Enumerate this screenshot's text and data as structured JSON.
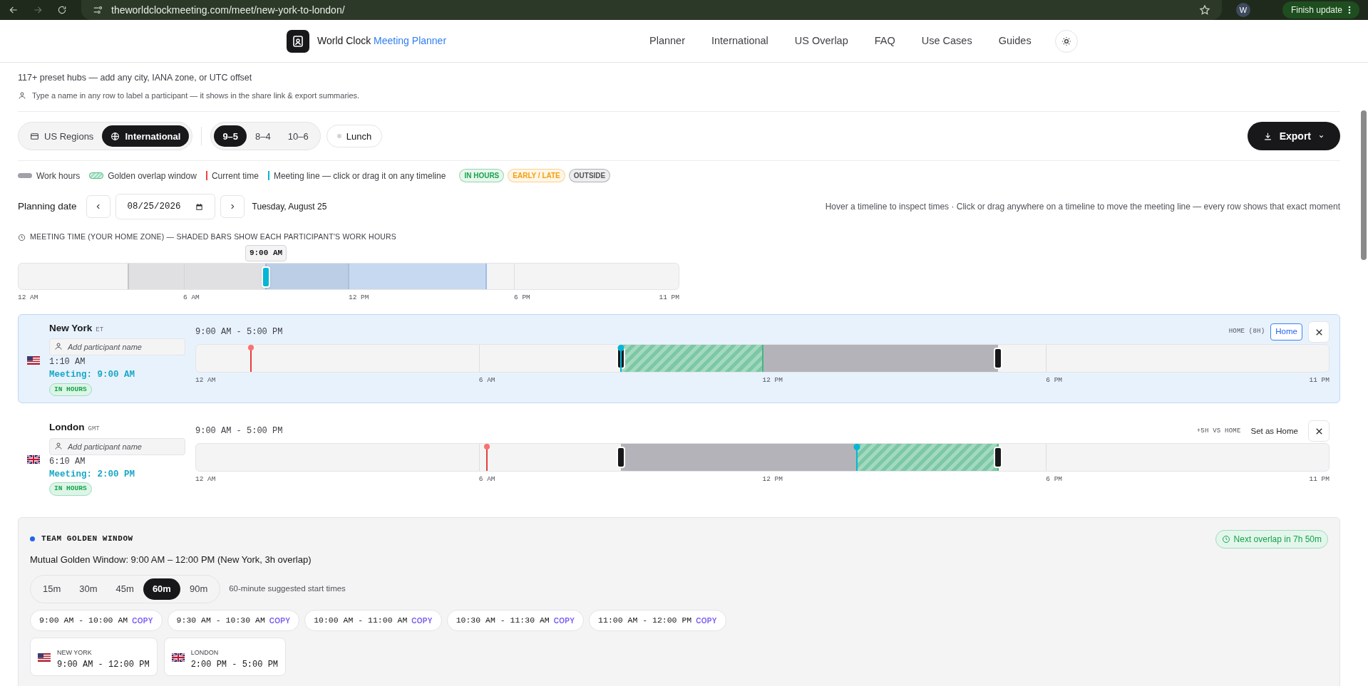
{
  "browser": {
    "url": "theworldclockmeeting.com/meet/new-york-to-london/",
    "avatar": "W",
    "update_button": "Finish update"
  },
  "header": {
    "logo_text": "World Clock",
    "logo_accent": "Meeting Planner",
    "nav": [
      "Planner",
      "International",
      "US Overlap",
      "FAQ",
      "Use Cases",
      "Guides"
    ]
  },
  "intro": {
    "subtitle": "117+ preset hubs — add any city, IANA zone, or UTC offset",
    "hint": "Type a name in any row to label a participant — it shows in the share link & export summaries."
  },
  "region_tabs": [
    {
      "label": "US Regions",
      "kind": "card",
      "selected": false
    },
    {
      "label": "International",
      "kind": "globe",
      "selected": true
    }
  ],
  "hour_presets": [
    {
      "label": "9–5",
      "selected": true
    },
    {
      "label": "8–4",
      "selected": false
    },
    {
      "label": "10–6",
      "selected": false
    }
  ],
  "lunch": {
    "label": "Lunch",
    "on": false
  },
  "export_button": "Export",
  "legend": [
    {
      "label": "Work hours",
      "kind": "work"
    },
    {
      "label": "Golden overlap window",
      "kind": "golden"
    },
    {
      "label": "Current time",
      "kind": "current"
    },
    {
      "label": "Meeting line — click or drag it on any timeline",
      "kind": "meeting"
    }
  ],
  "status_badges": [
    {
      "label": "IN HOURS",
      "color": "#16a34a"
    },
    {
      "label": "EARLY / LATE",
      "color": "#f59e0b"
    },
    {
      "label": "OUTSIDE",
      "color": "#52525b"
    }
  ],
  "planning": {
    "label": "Planning date",
    "date": "08/25/2026",
    "weekday": "Tuesday, August 25",
    "help": "Hover a timeline to inspect times · Click or drag anywhere on a timeline to move the meeting line — every row shows that exact moment"
  },
  "meeting_bar": {
    "label": "MEETING TIME (YOUR HOME ZONE) — SHADED BARS SHOW EACH PARTICIPANT'S WORK HOURS",
    "tooltip": "9:00 AM",
    "level": 0.375,
    "bands": [
      {
        "kind": "other",
        "start": {
          "level": 0.1667
        },
        "end": {
          "level": 0.5
        }
      },
      {
        "kind": "home",
        "start": {
          "level": 0.375
        },
        "end": {
          "level": 0.7083
        }
      }
    ],
    "ticks": [
      "12 AM",
      "6 AM",
      "12 PM",
      "6 PM",
      "11 PM"
    ]
  },
  "rows": [
    {
      "city": "New York",
      "zone": "ET",
      "kind": "us",
      "home": true,
      "placeholder": "Add participant name",
      "local_time": "1:10 AM",
      "meeting": "Meeting: 9:00 AM",
      "status": "IN HOURS",
      "hours": "9:00 AM - 5:00 PM",
      "offset": "HOME (8H)",
      "home_action": "Home",
      "work": {
        "start": {
          "level": 0.375
        },
        "end": {
          "level": 0.7083
        }
      },
      "golden": {
        "start": {
          "level": 0.375
        },
        "end": {
          "level": 0.5
        }
      },
      "current": {
        "level": 0.0486
      },
      "meeting_line": {
        "level": 0.375
      },
      "ticks": [
        "12 AM",
        "6 AM",
        "12 PM",
        "6 PM",
        "11 PM"
      ]
    },
    {
      "city": "London",
      "zone": "GMT",
      "kind": "uk",
      "home": false,
      "placeholder": "Add participant name",
      "local_time": "6:10 AM",
      "meeting": "Meeting: 2:00 PM",
      "status": "IN HOURS",
      "hours": "9:00 AM - 5:00 PM",
      "offset": "+5H VS HOME",
      "home_action": "Set as Home",
      "work": {
        "start": {
          "level": 0.375
        },
        "end": {
          "level": 0.7083
        }
      },
      "golden": {
        "start": {
          "level": 0.5833
        },
        "end": {
          "level": 0.7083
        }
      },
      "current": {
        "level": 0.257
      },
      "meeting_line": {
        "level": 0.5833
      },
      "ticks": [
        "12 AM",
        "6 AM",
        "12 PM",
        "6 PM",
        "11 PM"
      ]
    }
  ],
  "golden_window": {
    "title": "TEAM GOLDEN WINDOW",
    "next_overlap": "Next overlap in 7h 50m",
    "summary": "Mutual Golden Window: 9:00 AM – 12:00 PM (New York, 3h overlap)",
    "durations": [
      {
        "label": "15m",
        "selected": false
      },
      {
        "label": "30m",
        "selected": false
      },
      {
        "label": "45m",
        "selected": false
      },
      {
        "label": "60m",
        "selected": true
      },
      {
        "label": "90m",
        "selected": false
      }
    ],
    "duration_note": "60-minute suggested start times",
    "slots": [
      {
        "time": "9:00 AM - 10:00 AM",
        "action": "COPY"
      },
      {
        "time": "9:30 AM - 10:30 AM",
        "action": "COPY"
      },
      {
        "time": "10:00 AM - 11:00 AM",
        "action": "COPY"
      },
      {
        "time": "10:30 AM - 11:30 AM",
        "action": "COPY"
      },
      {
        "time": "11:00 AM - 12:00 PM",
        "action": "COPY"
      }
    ],
    "cities": [
      {
        "kind": "us",
        "name": "NEW YORK",
        "range": "9:00 AM - 12:00 PM"
      },
      {
        "kind": "uk",
        "name": "LONDON",
        "range": "2:00 PM - 5:00 PM"
      }
    ]
  }
}
